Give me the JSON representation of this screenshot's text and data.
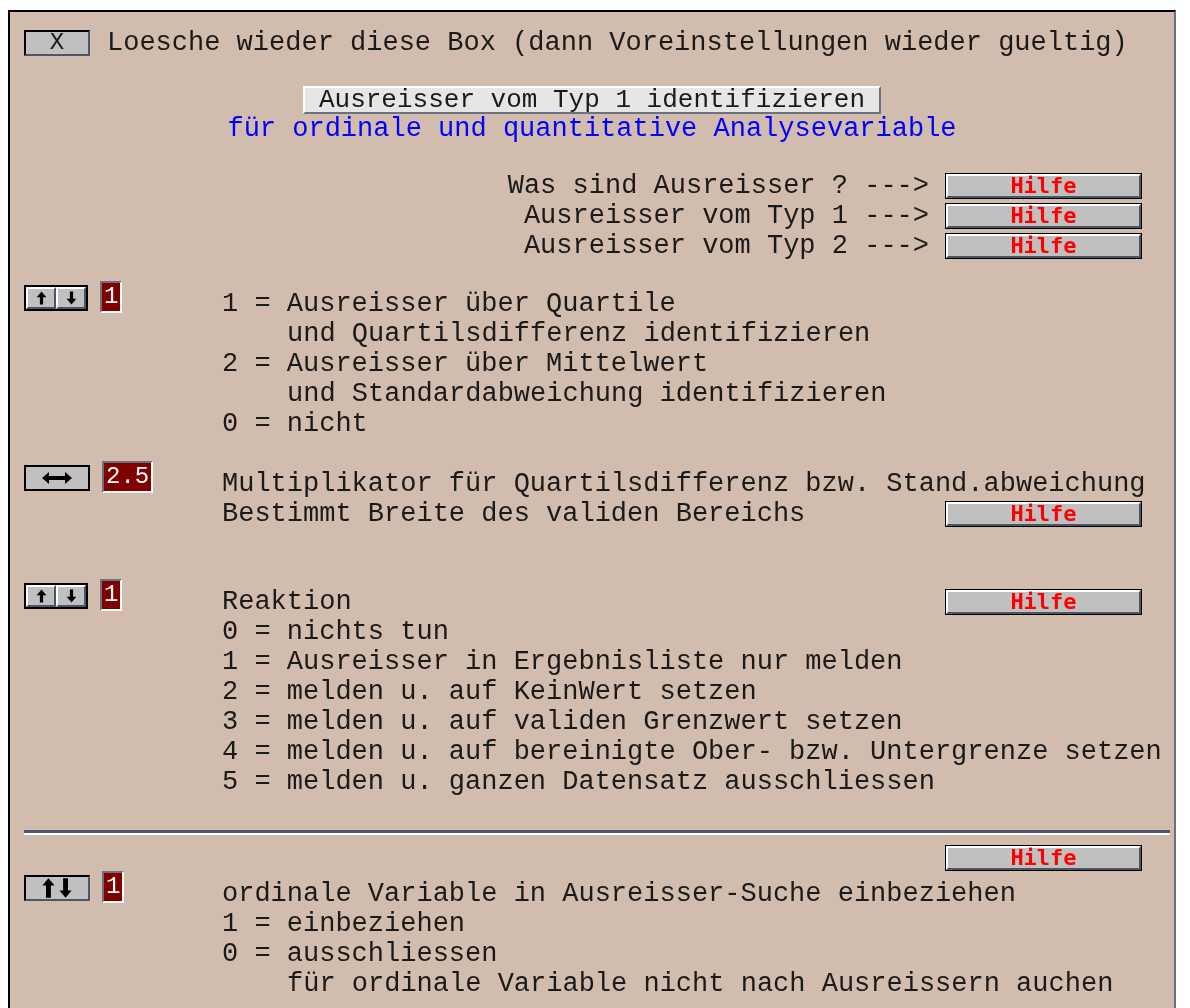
{
  "clear_button": {
    "label": "X",
    "text": "Loesche wieder diese Box (dann Voreinstellungen wieder gueltig)"
  },
  "title_button": "Ausreisser vom Typ 1 identifizieren",
  "subtitle": "für ordinale und quantitative Analysevariable",
  "help_links": [
    {
      "text": "Was sind Ausreisser ? --->",
      "button": "Hilfe"
    },
    {
      "text": "Ausreisser vom Typ 1 --->",
      "button": "Hilfe"
    },
    {
      "text": "Ausreisser vom Typ 2 --->",
      "button": "Hilfe"
    }
  ],
  "sections": [
    {
      "kind": "updown",
      "value": "1",
      "lines": [
        {
          "text": "1 = Ausreisser über Quartile",
          "children": [
            {
              "text": "und Quartilsdifferenz identifizieren"
            }
          ]
        },
        {
          "text": "2 = Ausreisser über Mittelwert",
          "children": [
            {
              "text": "und Standardabweichung identifizieren"
            }
          ]
        },
        {
          "text": "0 = nicht"
        }
      ]
    },
    {
      "kind": "leftright",
      "value": "2.5",
      "lines": [
        {
          "text": "Multiplikator für Quartilsdifferenz bzw. Stand.abweichung"
        },
        {
          "text": "Bestimmt Breite des validen Bereichs",
          "help": "Hilfe"
        }
      ]
    },
    {
      "kind": "updown",
      "value": "1",
      "lines": [
        {
          "text": "Reaktion",
          "help": "Hilfe"
        },
        {
          "text": "0 = nichts tun"
        },
        {
          "text": "1 = Ausreisser in Ergebnisliste nur melden"
        },
        {
          "text": "2 = melden u. auf KeinWert setzen"
        },
        {
          "text": "3 = melden u. auf validen Grenzwert setzen"
        },
        {
          "text": "4 = melden u. auf bereinigte Ober- bzw. Untergrenze setzen"
        },
        {
          "text": "5 = melden u. ganzen Datensatz ausschliessen"
        }
      ]
    },
    {
      "kind": "updown-compact",
      "value": "1",
      "divider_above": true,
      "help_above": "Hilfe",
      "lines": [
        {
          "text": "ordinale Variable in Ausreisser-Suche einbeziehen"
        },
        {
          "text": "1 = einbeziehen"
        },
        {
          "text": "0 = ausschliessen",
          "children": [
            {
              "text": "für ordinale Variable nicht nach Ausreissern auchen"
            }
          ]
        }
      ]
    }
  ]
}
